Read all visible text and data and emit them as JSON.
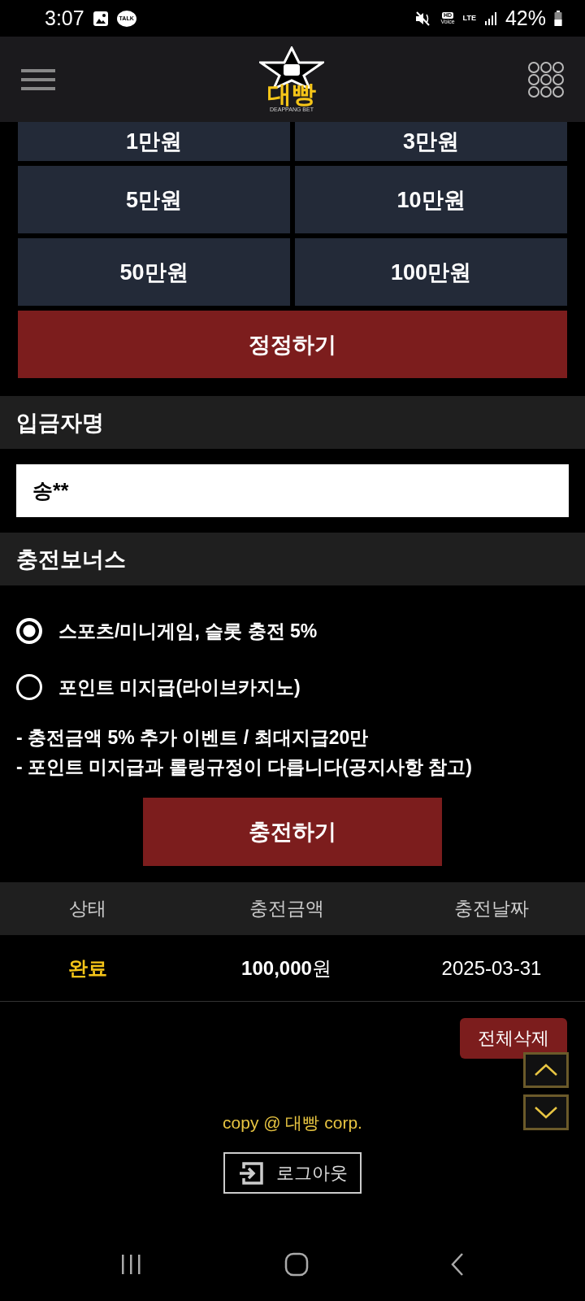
{
  "status_bar": {
    "time": "3:07",
    "talk_label": "TALK",
    "hd_label": "HD",
    "voice_label": "Voice",
    "network": "LTE",
    "battery": "42%"
  },
  "header": {
    "logo_text": "대빵",
    "logo_subtext": "DEAPPANG BET"
  },
  "amount_buttons": [
    "1만원",
    "3만원",
    "5만원",
    "10만원",
    "50만원",
    "100만원"
  ],
  "correct_button": "정정하기",
  "depositor": {
    "label": "입금자명",
    "value": "송**"
  },
  "bonus": {
    "label": "충전보너스",
    "options": [
      {
        "label": "스포츠/미니게임, 슬롯 충전 5%",
        "selected": true
      },
      {
        "label": "포인트 미지급(라이브카지노)",
        "selected": false
      }
    ],
    "notes": [
      "- 충전금액 5% 추가 이벤트 / 최대지급20만",
      "- 포인트 미지급과 롤링규정이 다릅니다(공지사항 참고)"
    ]
  },
  "charge_button": "충전하기",
  "history": {
    "columns": [
      "상태",
      "충전금액",
      "충전날짜"
    ],
    "rows": [
      {
        "status": "완료",
        "amount": "**100,000**원",
        "date": "2025-03-31"
      }
    ]
  },
  "delete_all_button": "전체삭제",
  "footer": {
    "copyright": "copy @ 대빵 corp.",
    "logout_button": "로그아웃"
  }
}
